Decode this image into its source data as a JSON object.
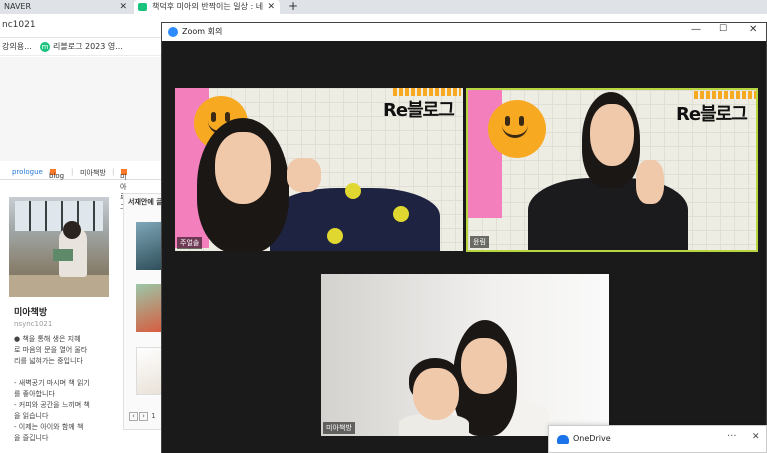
{
  "browser": {
    "tabs": [
      {
        "label": "NAVER"
      },
      {
        "label": "책덕후 미아의 반짝이는 일상 : 네"
      }
    ],
    "address": "nc1021",
    "bookmarks": [
      {
        "label": "강의용..."
      },
      {
        "label": "리블로그 2023 영..."
      }
    ]
  },
  "blog": {
    "nav": {
      "prologue": "prologue",
      "blog": "blog",
      "sep": "|",
      "miachaekbang": "미아책방",
      "mialog": "미아로그"
    },
    "profile": {
      "name": "미아책방",
      "id": "nsync1021",
      "description": "● 책을 통해 생은 지혜\n로 마음의 문을 열어 울타\n리를 넓혀가는 중입니다\n\n- 새벽공기 마시며 책 읽기\n를 좋아합니다\n- 커피와 공간을 느끼며 책\n을 읽습니다\n- 이제는 아이와 함께 책\n을 즐깁니다"
    },
    "books_panel": {
      "title": "서재안에 글",
      "pager_prev": "‹",
      "pager_next": "›",
      "pager_page": "1"
    }
  },
  "zoom": {
    "title": "Zoom 회의",
    "window_controls": {
      "minimize": "—",
      "maximize": "☐",
      "close": "✕"
    },
    "participants": [
      {
        "name": "주얼솔",
        "brand": "Re블로그"
      },
      {
        "name": "윤림",
        "brand": "Re블로그",
        "active_speaker": true
      },
      {
        "name": "미아책방"
      }
    ],
    "active_speaker_color": "#b7d63f"
  },
  "notification": {
    "label": "OneDrive",
    "more": "···",
    "close": "✕"
  }
}
